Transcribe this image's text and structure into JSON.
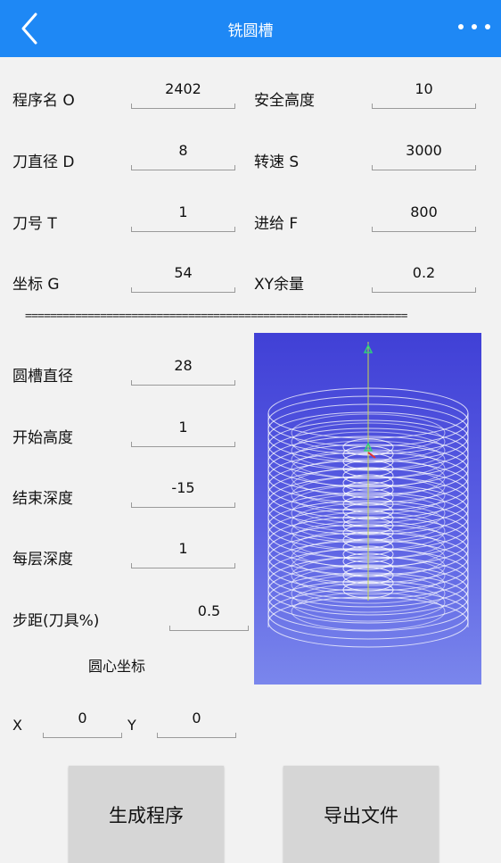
{
  "header": {
    "title": "铣圆槽",
    "back_icon": "chevron-left-icon",
    "more_icon": "more-dots-icon",
    "color": "#1e88f5"
  },
  "params": {
    "program_label": "程序名 O",
    "program_value": "2402",
    "safe_height_label": "安全高度",
    "safe_height_value": "10",
    "tool_dia_label": "刀直径 D",
    "tool_dia_value": "8",
    "speed_label": "转速 S",
    "speed_value": "3000",
    "tool_no_label": "刀号 T",
    "tool_no_value": "1",
    "feed_label": "进给 F",
    "feed_value": "800",
    "coord_label": "坐标 G",
    "coord_value": "54",
    "xy_allow_label": "XY余量",
    "xy_allow_value": "0.2"
  },
  "divider": "=============================================================",
  "slot": {
    "diameter_label": "圆槽直径",
    "diameter_value": "28",
    "start_height_label": "开始高度",
    "start_height_value": "1",
    "end_depth_label": "结束深度",
    "end_depth_value": "-15",
    "layer_depth_label": "每层深度",
    "layer_depth_value": "1",
    "step_label": "步距(刀具%)",
    "step_value": "0.5",
    "center_label": "圆心坐标",
    "x_label": "X",
    "x_value": "0",
    "y_label": "Y",
    "y_value": "0"
  },
  "actions": {
    "generate_label": "生成程序",
    "export_label": "导出文件"
  }
}
